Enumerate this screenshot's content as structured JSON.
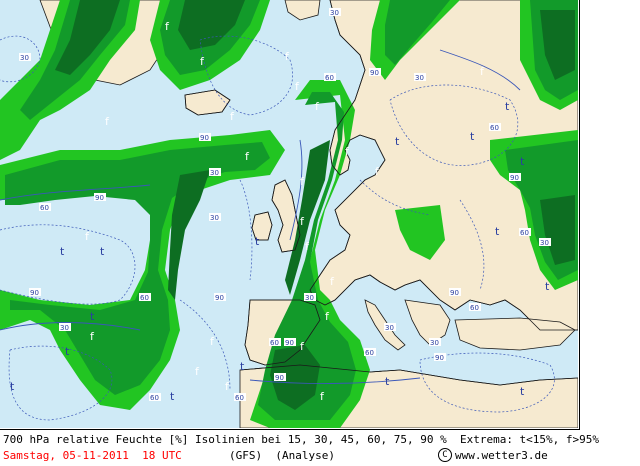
{
  "colors": {
    "sea": "#cfeaf6",
    "land": "#f6ead0",
    "green_light": "#22c522",
    "green_mid": "#129a2a",
    "green_dark": "#0d6e22",
    "isoline": "#3a57b8",
    "coast": "#1a1a1a"
  },
  "map": {
    "markers_f": [
      "f",
      "f",
      "f",
      "f",
      "f",
      "f",
      "f",
      "f",
      "f",
      "f",
      "f",
      "f",
      "f",
      "f",
      "f",
      "f",
      "f",
      "f",
      "f",
      "f",
      "f",
      "f",
      "f"
    ],
    "markers_t": [
      "t",
      "t",
      "t",
      "t",
      "t",
      "t",
      "t",
      "t",
      "t",
      "t",
      "t",
      "t",
      "t",
      "t",
      "t",
      "t"
    ],
    "isoline_labels": [
      "30",
      "60",
      "90",
      "30",
      "60",
      "90",
      "30",
      "60",
      "90",
      "30",
      "60",
      "90",
      "30",
      "60",
      "90",
      "30",
      "60",
      "90",
      "30",
      "60",
      "90",
      "30",
      "60",
      "90",
      "30",
      "60",
      "90",
      "30",
      "60",
      "90"
    ]
  },
  "footer": {
    "line1": "700 hPa relative Feuchte [%] Isolinien bei 15, 30, 45, 60, 75, 90 %  Extrema: t<15%, f>95%",
    "date_time": "Samstag, 05-11-2011  18 UTC",
    "model": "(GFS)  (Analyse)",
    "copyright_symbol": "C",
    "website": "www.wetter3.de"
  }
}
